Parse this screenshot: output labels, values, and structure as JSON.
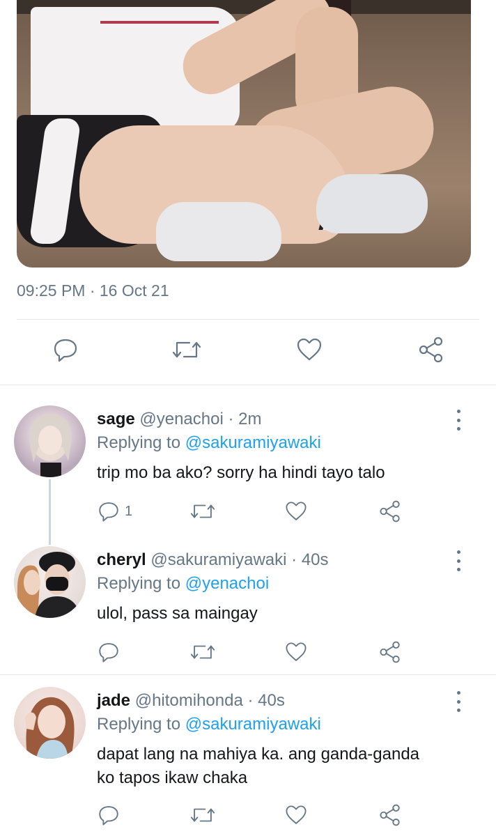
{
  "tweet": {
    "timestamp": "09:25 PM · 16 Oct 21",
    "actions": [
      {
        "name": "reply-icon"
      },
      {
        "name": "retweet-icon"
      },
      {
        "name": "like-icon"
      },
      {
        "name": "share-icon"
      }
    ]
  },
  "replies": [
    {
      "display_name": "sage",
      "handle": "@yenachoi",
      "time": " · 2m",
      "replying_prefix": "Replying to ",
      "replying_to": "@sakuramiyawaki",
      "text": "trip mo ba ako? sorry ha hindi tayo talo",
      "reply_count": "1"
    },
    {
      "display_name": "cheryl",
      "handle": "@sakuramiyawaki",
      "time": " · 40s",
      "replying_prefix": "Replying to ",
      "replying_to": "@yenachoi",
      "text": "ulol, pass sa maingay",
      "reply_count": ""
    },
    {
      "display_name": "jade",
      "handle": "@hitomihonda",
      "time": " · 40s",
      "replying_prefix": "Replying to ",
      "replying_to": "@sakuramiyawaki",
      "text": "dapat lang na mahiya ka. ang ganda-ganda ko tapos ikaw chaka",
      "reply_count": ""
    }
  ],
  "colors": {
    "secondary_text": "#657786",
    "mention": "#1da1f2",
    "divider": "#e1e8ed"
  }
}
